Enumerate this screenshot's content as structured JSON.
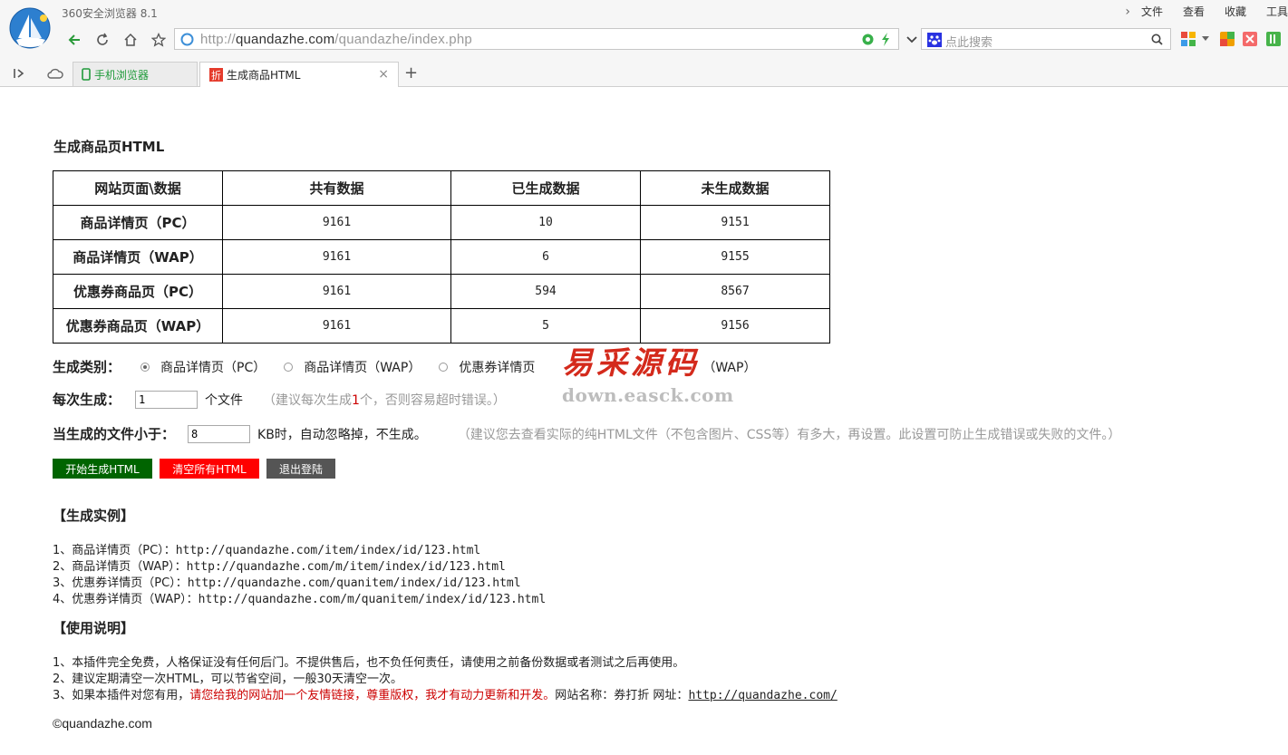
{
  "browser": {
    "app_title": "360安全浏览器 8.1",
    "menu": [
      "文件",
      "查看",
      "收藏",
      "工具"
    ],
    "url_prefix": "http://",
    "url_domain": "quandazhe.com",
    "url_path": "/quandazhe/index.php",
    "search_placeholder": "点此搜索",
    "tabs": [
      {
        "label": "手机浏览器",
        "color": "#1f9a3a"
      },
      {
        "label": "生成商品HTML",
        "color": "#222222"
      }
    ]
  },
  "page": {
    "title": "生成商品页HTML",
    "table": {
      "headers": [
        "网站页面\\数据",
        "共有数据",
        "已生成数据",
        "未生成数据"
      ],
      "rows": [
        {
          "name": "商品详情页（PC）",
          "total": "9161",
          "generated": "10",
          "pending": "9151"
        },
        {
          "name": "商品详情页（WAP）",
          "total": "9161",
          "generated": "6",
          "pending": "9155"
        },
        {
          "name": "优惠券商品页（PC）",
          "total": "9161",
          "generated": "594",
          "pending": "8567"
        },
        {
          "name": "优惠券商品页（WAP）",
          "total": "9161",
          "generated": "5",
          "pending": "9156"
        }
      ]
    },
    "type_row": {
      "label": "生成类别：",
      "options": [
        "商品详情页（PC）",
        "商品详情页（WAP）",
        "优惠券详情页",
        "（WAP）"
      ],
      "selected_index": 0
    },
    "batch_row": {
      "label": "每次生成：",
      "value": "1",
      "unit": "个文件",
      "hint_a": "（建议每次生成",
      "hint_num": "1",
      "hint_b": "个，否则容易超时错误。）"
    },
    "size_row": {
      "label": "当生成的文件小于：",
      "value": "8",
      "unit": "KB时，自动忽略掉，不生成。",
      "hint": "（建议您去查看实际的纯HTML文件（不包含图片、CSS等）有多大，再设置。此设置可防止生成错误或失败的文件。）"
    },
    "buttons": {
      "start": "开始生成HTML",
      "clear": "清空所有HTML",
      "logout": "退出登陆"
    },
    "examples": {
      "title": "【生成实例】",
      "items": [
        {
          "prefix": "1、商品详情页（PC）：",
          "url": "http://quandazhe.com/item/index/id/123.html"
        },
        {
          "prefix": "2、商品详情页（WAP）：",
          "url": "http://quandazhe.com/m/item/index/id/123.html"
        },
        {
          "prefix": "3、优惠券详情页（PC）：",
          "url": "http://quandazhe.com/quanitem/index/id/123.html"
        },
        {
          "prefix": "4、优惠券详情页（WAP）：",
          "url": "http://quandazhe.com/m/quanitem/index/id/123.html"
        }
      ]
    },
    "usage": {
      "title": "【使用说明】",
      "line1": "1、本插件完全免费，人格保证没有任何后门。不提供售后，也不负任何责任，请使用之前备份数据或者测试之后再使用。",
      "line2": "2、建议定期清空一次HTML，可以节省空间，一般30天清空一次。",
      "line3_a": "3、如果本插件对您有用，",
      "line3_red": "请您给我的网站加一个友情链接，尊重版权，我才有动力更新和开发。",
      "line3_b": "网站名称：券打折    网址：",
      "line3_link": "http://quandazhe.com/"
    },
    "copyright": "©quandazhe.com"
  },
  "watermark": {
    "cn": "易采源码",
    "en": "down.easck.com"
  },
  "colors": {
    "start_btn": "#006400",
    "clear_btn": "#ff0000",
    "logout_btn": "#555555",
    "red_text": "#cc0000",
    "hint": "#999999"
  }
}
